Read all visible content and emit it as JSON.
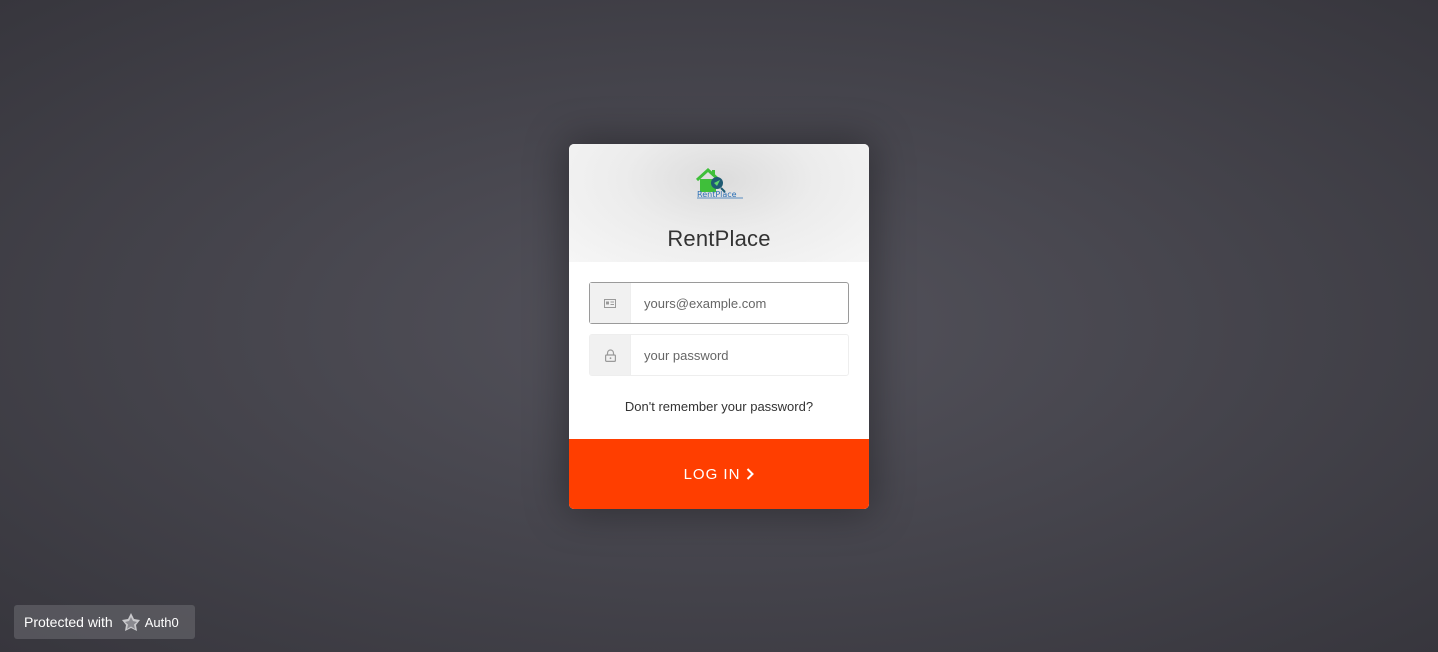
{
  "brand": {
    "name": "RentPlace",
    "logo_text": "RentPlace",
    "logo_icon": "house-icon"
  },
  "form": {
    "email_placeholder": "yours@example.com",
    "email_icon": "id-card-icon",
    "password_placeholder": "your password",
    "password_icon": "lock-icon",
    "forgot_label": "Don't remember your password?",
    "submit_label": "LOG IN"
  },
  "badge": {
    "prefix": "Protected with",
    "provider": "Auth0",
    "icon": "auth0-shield-icon"
  },
  "colors": {
    "accent": "#ff3e00",
    "background": "#47464e",
    "logo_green": "#3fbf3a"
  }
}
